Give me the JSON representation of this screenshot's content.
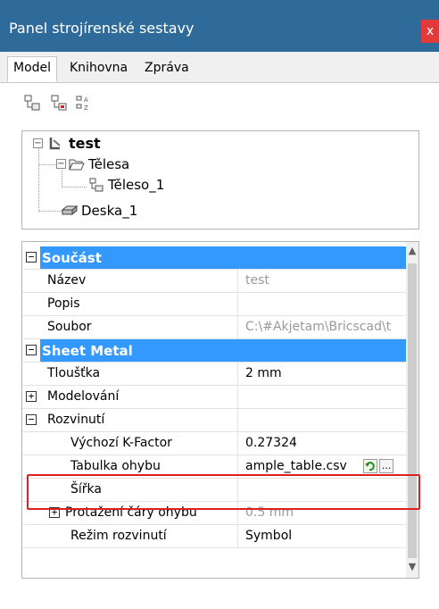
{
  "window": {
    "title": "Panel strojírenské sestavy",
    "close_glyph": "x"
  },
  "tabs": [
    {
      "label": "Model",
      "active": true
    },
    {
      "label": "Knihovna",
      "active": false
    },
    {
      "label": "Zpráva",
      "active": false
    }
  ],
  "toolbar": {
    "icons": [
      "component-icon",
      "component-remove-icon",
      "sort-az-icon"
    ]
  },
  "tree": {
    "root": {
      "label": "test",
      "icon": "assembly-icon"
    },
    "items": [
      {
        "label": "Tělesa",
        "icon": "folder-open-icon"
      },
      {
        "label": "Těleso_1",
        "icon": "body-icon"
      },
      {
        "label": "Deska_1",
        "icon": "sheet-metal-icon"
      }
    ]
  },
  "properties": {
    "rows": [
      {
        "type": "category",
        "label": "Součást",
        "toggle": "−"
      },
      {
        "type": "prop",
        "name": "Název",
        "value": "test",
        "muted": true
      },
      {
        "type": "prop",
        "name": "Popis",
        "value": ""
      },
      {
        "type": "prop",
        "name": "Soubor",
        "value": "C:\\#Akjetam\\Bricscad\\t",
        "muted": true
      },
      {
        "type": "category",
        "label": "Sheet Metal",
        "toggle": "−"
      },
      {
        "type": "prop",
        "name": "Tloušťka",
        "value": "2 mm"
      },
      {
        "type": "group",
        "name": "Modelování",
        "toggle": "+",
        "value": ""
      },
      {
        "type": "group",
        "name": "Rozvinutí",
        "toggle": "−",
        "value": ""
      },
      {
        "type": "sub",
        "name": "Výchozí K-Factor",
        "value": "0.27324"
      },
      {
        "type": "sub",
        "name": "Tabulka ohybu",
        "value": "ample_table.csv"
      },
      {
        "type": "sub",
        "name": "Šířka",
        "value": ""
      },
      {
        "type": "subgroup",
        "name": "Protažení čáry ohybu",
        "toggle": "+",
        "value": "0.5 mm",
        "muted": true
      },
      {
        "type": "sub",
        "name": "Režim rozvinutí",
        "value": "Symbol"
      }
    ],
    "browse_label": "...",
    "reset_glyph": "↶"
  },
  "colors": {
    "title_bar": "#2f6b9a",
    "category_bg": "#3399ff",
    "highlight_box": "#e02020"
  }
}
